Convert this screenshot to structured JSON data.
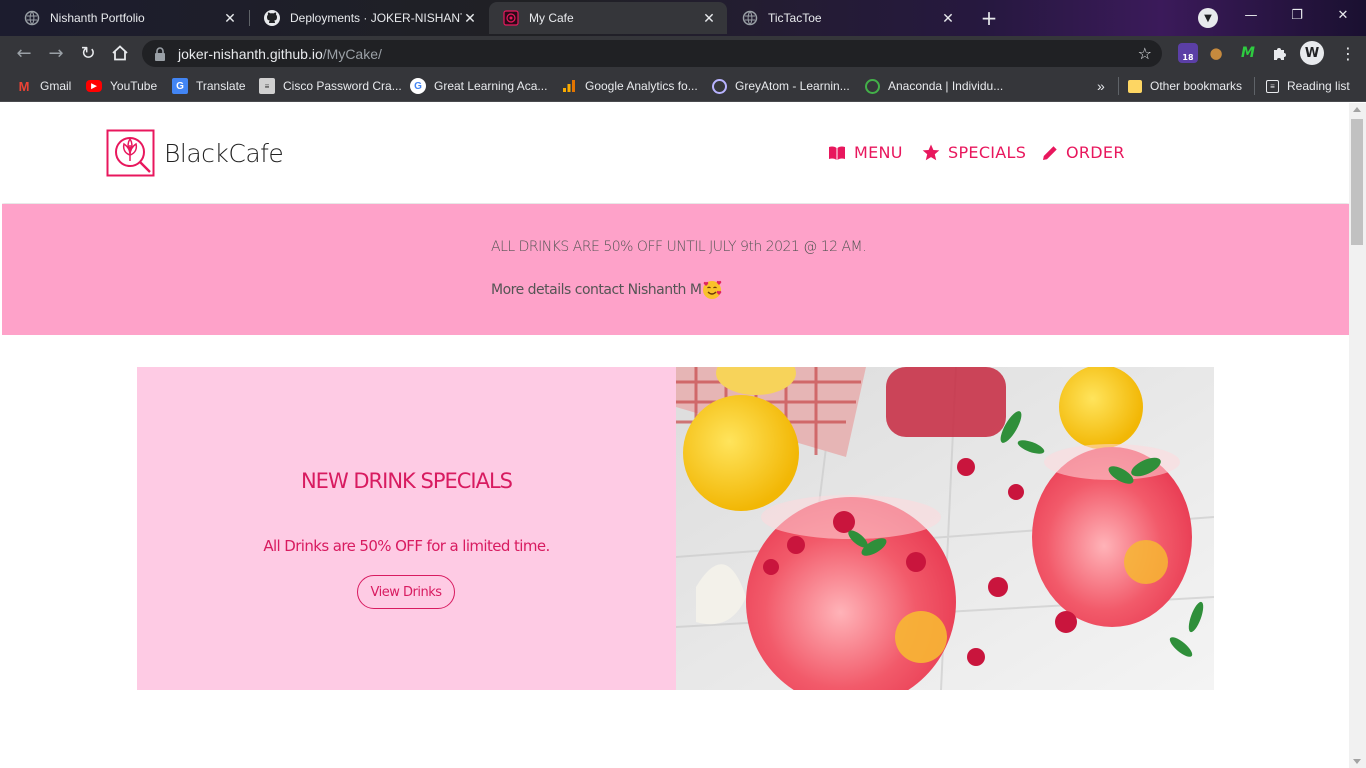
{
  "browser": {
    "tabs": [
      {
        "title": "Nishanth Portfolio",
        "active": false,
        "icon": "globe-icon"
      },
      {
        "title": "Deployments · JOKER-NISHANTH",
        "active": false,
        "icon": "github-icon"
      },
      {
        "title": "My Cafe",
        "active": true,
        "icon": "cafe-icon"
      },
      {
        "title": "TicTacToe",
        "active": false,
        "icon": "globe-icon"
      }
    ],
    "tab_close": "✕",
    "new_tab": "+",
    "url_host": "joker-nishanth.github.io",
    "url_path": "/MyCake/",
    "extension_badge": "18",
    "window_controls": {
      "minimize": "—",
      "restore": "❐",
      "close": "✕"
    },
    "bookmarks": [
      {
        "label": "Gmail",
        "icon": "gmail-icon"
      },
      {
        "label": "YouTube",
        "icon": "youtube-icon"
      },
      {
        "label": "Translate",
        "icon": "translate-icon"
      },
      {
        "label": "Cisco Password Cra...",
        "icon": "cisco-icon"
      },
      {
        "label": "Great Learning Aca...",
        "icon": "google-icon"
      },
      {
        "label": "Google Analytics fo...",
        "icon": "analytics-icon"
      },
      {
        "label": "GreyAtom - Learnin...",
        "icon": "greyatom-icon"
      },
      {
        "label": "Anaconda | Individu...",
        "icon": "anaconda-icon"
      }
    ],
    "bookmarks_overflow": "»",
    "other_bookmarks": "Other bookmarks",
    "reading_list": "Reading list"
  },
  "site": {
    "logo_text": "BlackCafe",
    "nav": [
      {
        "label": "MENU",
        "icon": "book-icon"
      },
      {
        "label": "SPECIALS",
        "icon": "star-icon"
      },
      {
        "label": "ORDER",
        "icon": "pencil-icon"
      }
    ],
    "promo": {
      "line1": "ALL DRINKS ARE 50% OFF UNTIL JULY 9th 2021 @ 12 AM.",
      "line2": "More details contact Nishanth M"
    },
    "specials": {
      "title": "NEW DRINK SPECIALS",
      "description": "All Drinks are 50% OFF for a limited time.",
      "button": "View Drinks"
    }
  },
  "colors": {
    "accent": "#e8175d",
    "promo_bg": "#fea2c9",
    "card_bg": "#fecbe4",
    "chrome_bg": "#35363a"
  }
}
